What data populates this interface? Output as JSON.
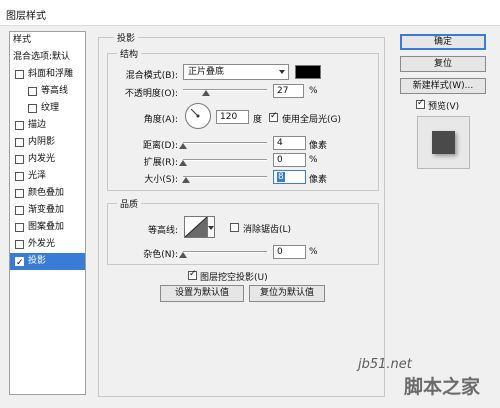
{
  "window": {
    "title": "图层样式"
  },
  "sidebar": {
    "header": "样式",
    "blend_options": "混合选项:默认",
    "items": [
      {
        "label": "斜面和浮雕",
        "checked": false,
        "indent": 0
      },
      {
        "label": "等高线",
        "checked": false,
        "indent": 1
      },
      {
        "label": "纹理",
        "checked": false,
        "indent": 1
      },
      {
        "label": "描边",
        "checked": false,
        "indent": 0
      },
      {
        "label": "内阴影",
        "checked": false,
        "indent": 0
      },
      {
        "label": "内发光",
        "checked": false,
        "indent": 0
      },
      {
        "label": "光泽",
        "checked": false,
        "indent": 0
      },
      {
        "label": "颜色叠加",
        "checked": false,
        "indent": 0
      },
      {
        "label": "渐变叠加",
        "checked": false,
        "indent": 0
      },
      {
        "label": "图案叠加",
        "checked": false,
        "indent": 0
      },
      {
        "label": "外发光",
        "checked": false,
        "indent": 0
      },
      {
        "label": "投影",
        "checked": true,
        "indent": 0,
        "selected": true
      }
    ]
  },
  "drop_shadow": {
    "section_title": "投影",
    "structure": {
      "legend": "结构",
      "blend_mode_label": "混合模式(B):",
      "blend_mode_value": "正片叠底",
      "shadow_color": "#000000",
      "opacity_label": "不透明度(O):",
      "opacity_value": "27",
      "opacity_unit": "%",
      "angle_label": "角度(A):",
      "angle_value": "120",
      "angle_unit": "度",
      "global_light_label": "使用全局光(G)",
      "global_light_checked": true,
      "distance_label": "距离(D):",
      "distance_value": "4",
      "distance_unit": "像素",
      "spread_label": "扩展(R):",
      "spread_value": "0",
      "spread_unit": "%",
      "size_label": "大小(S):",
      "size_value": "8",
      "size_unit": "像素"
    },
    "quality": {
      "legend": "品质",
      "contour_label": "等高线:",
      "antialias_label": "消除锯齿(L)",
      "antialias_checked": false,
      "noise_label": "杂色(N):",
      "noise_value": "0",
      "noise_unit": "%"
    },
    "knockout_label": "图层挖空投影(U)",
    "knockout_checked": true,
    "set_default_label": "设置为默认值",
    "reset_default_label": "复位为默认值"
  },
  "buttons": {
    "ok": "确定",
    "reset": "复位",
    "new_style": "新建样式(W)...",
    "preview_label": "预览(V)",
    "preview_checked": true
  },
  "watermark": {
    "site": "jb51.net",
    "brand": "脚本之家"
  },
  "colors": {
    "selection": "#3a7bd5",
    "preview_swatch": "#4a4a4a"
  }
}
